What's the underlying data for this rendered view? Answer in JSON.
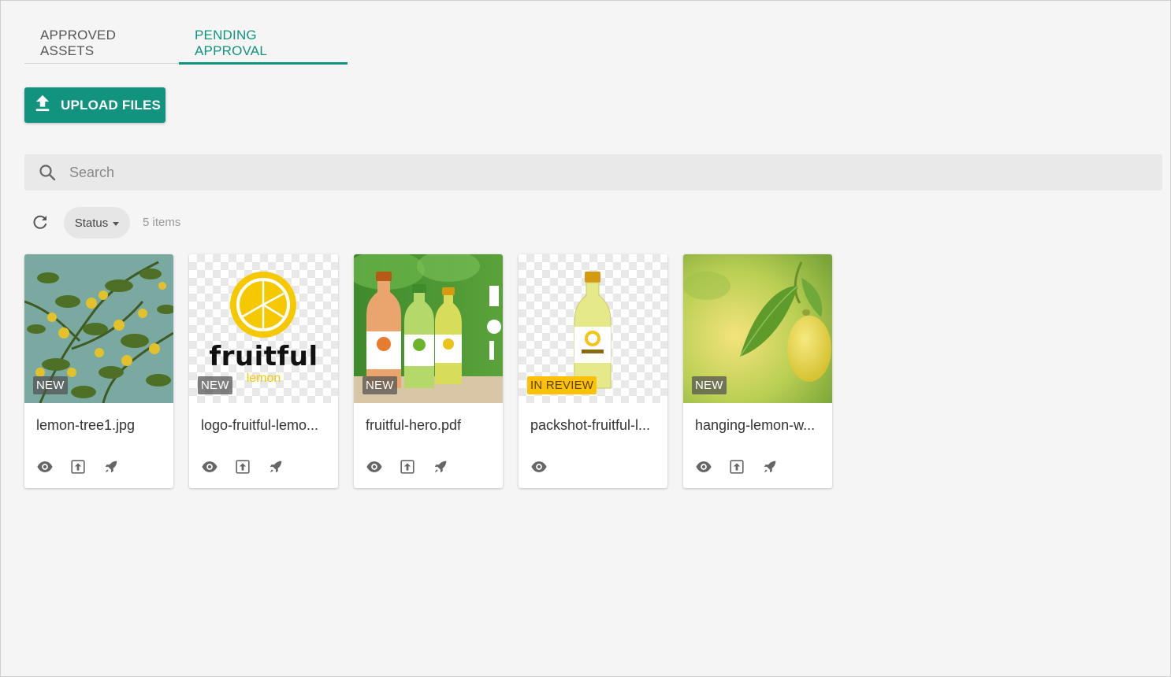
{
  "tabs": [
    {
      "label": "APPROVED ASSETS",
      "active": false
    },
    {
      "label": "PENDING APPROVAL",
      "active": true
    }
  ],
  "upload": {
    "label": "UPLOAD FILES",
    "icon": "upload-icon"
  },
  "search": {
    "placeholder": "Search",
    "value": "",
    "icon": "search-icon"
  },
  "filters": {
    "status_label": "Status",
    "items_count": "5 items",
    "refresh_icon": "refresh-icon"
  },
  "colors": {
    "accent": "#12937f",
    "review_badge": "#ffc107",
    "new_badge": "#505050"
  },
  "cards": [
    {
      "filename": "lemon-tree1.jpg",
      "badge": "NEW",
      "thumbnail": "lemon tree against teal sky",
      "actions": [
        "eye-icon",
        "publish-icon",
        "rocket-icon"
      ]
    },
    {
      "filename": "logo-fruitful-lemo...",
      "badge": "NEW",
      "thumbnail": "fruitful lemon logo",
      "logo_text": {
        "brand": "fruitful",
        "sub": "lemon"
      },
      "actions": [
        "eye-icon",
        "publish-icon",
        "rocket-icon"
      ]
    },
    {
      "filename": "fruitful-hero.pdf",
      "badge": "NEW",
      "thumbnail": "three fruitful bottles",
      "actions": [
        "eye-icon",
        "publish-icon",
        "rocket-icon"
      ]
    },
    {
      "filename": "packshot-fruitful-l...",
      "badge": "IN REVIEW",
      "thumbnail": "fruitful lemon bottle packshot",
      "actions": [
        "eye-icon"
      ]
    },
    {
      "filename": "hanging-lemon-w...",
      "badge": "NEW",
      "thumbnail": "hanging lemon with leaves",
      "actions": [
        "eye-icon",
        "publish-icon",
        "rocket-icon"
      ]
    }
  ]
}
